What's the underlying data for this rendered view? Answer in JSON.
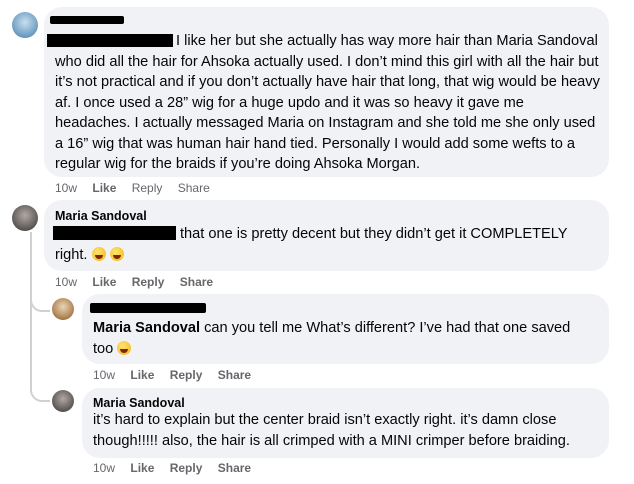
{
  "comments": [
    {
      "text": "I like her but she actually has way more hair than Maria Sandoval who did all the hair for Ahsoka actually used. I don’t mind this girl with all the hair but it’s not practical and if you don’t actually have hair that long, that wig would be heavy af. I once used a 28” wig for a huge updo and it was so heavy it gave me headaches. I actually messaged Maria on Instagram and she told me she only used a 16” wig that was human hair hand tied. Personally I would add some wefts to a regular wig for the braids if you’re doing Ahsoka Morgan.",
      "time": "10w",
      "like": "Like",
      "reply": "Reply",
      "share": "Share"
    },
    {
      "author": "Maria Sandoval",
      "text": "that one is pretty decent but they didn’t get it COMPLETELY right.",
      "time": "10w",
      "like": "Like",
      "reply": "Reply",
      "share": "Share"
    },
    {
      "mention": "Maria Sandoval",
      "text": "can you tell me What’s different? I’ve had that one saved too",
      "time": "10w",
      "like": "Like",
      "reply": "Reply",
      "share": "Share"
    },
    {
      "author": "Maria Sandoval",
      "text": "it’s hard to explain but the center braid isn’t exactly right. it’s damn close though!!!!! also, the hair is all crimped with a MINI crimper before braiding.",
      "time": "10w",
      "like": "Like",
      "reply": "Reply",
      "share": "Share"
    }
  ]
}
